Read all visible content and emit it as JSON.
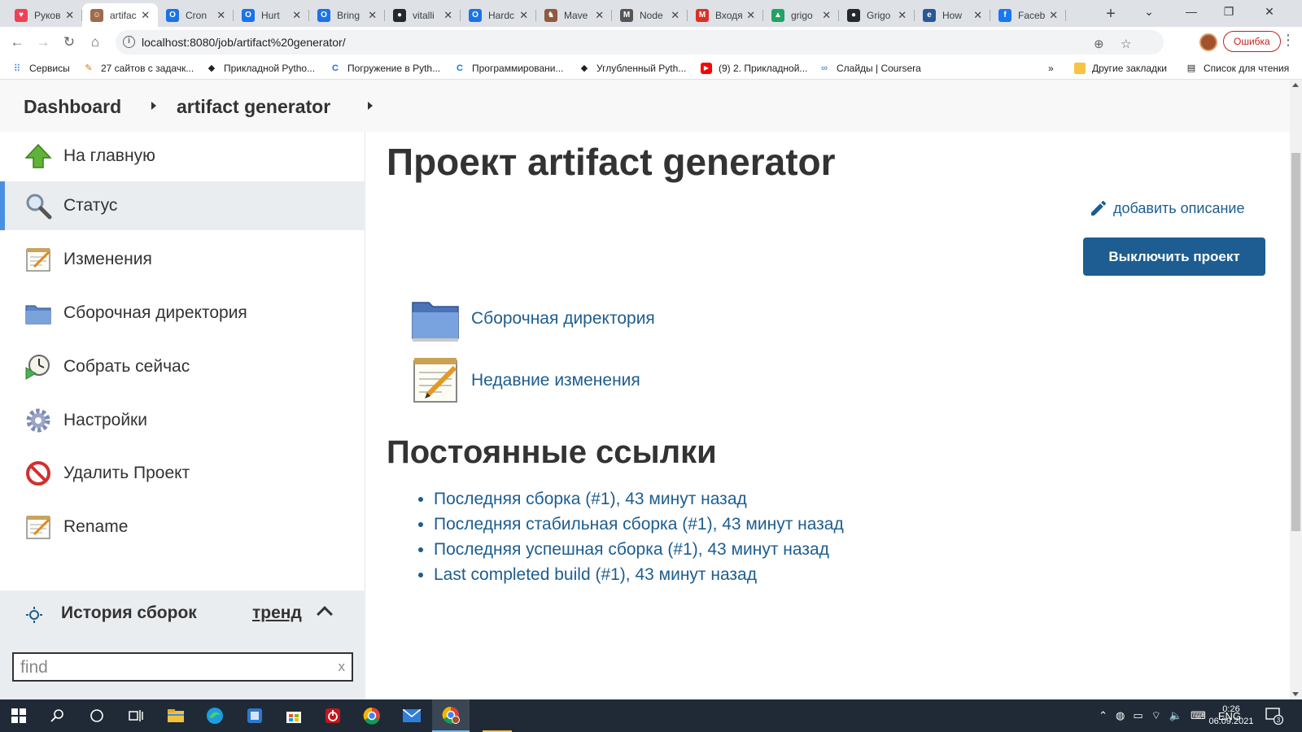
{
  "browser": {
    "tabs": [
      {
        "title": "Руков",
        "icon": "pocket-icon",
        "color": "#ef4056"
      },
      {
        "title": "artifac",
        "icon": "jenkins-icon",
        "color": "#a06a4c",
        "active": true
      },
      {
        "title": "Cron",
        "icon": "opera-icon",
        "color": "#1a73e8"
      },
      {
        "title": "Hurt",
        "icon": "opera-icon",
        "color": "#1a73e8"
      },
      {
        "title": "Bring",
        "icon": "opera-icon",
        "color": "#1a73e8"
      },
      {
        "title": "vitalli",
        "icon": "github-icon",
        "color": "#24292e"
      },
      {
        "title": "Hardc",
        "icon": "opera-icon",
        "color": "#1a73e8"
      },
      {
        "title": "Mave",
        "icon": "maven-icon",
        "color": "#8e5a40"
      },
      {
        "title": "Node",
        "icon": "mail-icon",
        "color": "#555555"
      },
      {
        "title": "Входя",
        "icon": "gmail-icon",
        "color": "#d93025"
      },
      {
        "title": "grigo",
        "icon": "drive-icon",
        "color": "#1fa463"
      },
      {
        "title": "Grigo",
        "icon": "github-icon",
        "color": "#24292e"
      },
      {
        "title": "How",
        "icon": "e-icon",
        "color": "#2b5797"
      },
      {
        "title": "Faceb",
        "icon": "facebook-icon",
        "color": "#1877f2"
      }
    ],
    "new_tab": "+",
    "url": "localhost:8080/job/artifact%20generator/",
    "error_label": "Ошибка",
    "bookmarks": [
      {
        "label": "Сервисы",
        "icon": "apps-icon"
      },
      {
        "label": "27 сайтов с задачк...",
        "icon": "bookmark-icon"
      },
      {
        "label": "Прикладной Pytho...",
        "icon": "stepik-icon"
      },
      {
        "label": "Погружение в Pyth...",
        "icon": "coursera-c-icon"
      },
      {
        "label": "Программировани...",
        "icon": "coursera-c-icon"
      },
      {
        "label": "Углубленный Pyth...",
        "icon": "stepik-icon"
      },
      {
        "label": "(9) 2. Прикладной...",
        "icon": "youtube-icon"
      },
      {
        "label": "Слайды | Coursera",
        "icon": "coursera-infinity-icon"
      }
    ],
    "bookmarks_more": "»",
    "other_bookmarks": "Другие закладки",
    "reading_list": "Список для чтения"
  },
  "jenkins": {
    "breadcrumb": [
      "Dashboard",
      "artifact generator"
    ],
    "sidebar": [
      {
        "label": "На главную",
        "icon": "up-arrow-icon"
      },
      {
        "label": "Статус",
        "icon": "search-icon",
        "active": true
      },
      {
        "label": "Изменения",
        "icon": "notepad-icon"
      },
      {
        "label": "Сборочная директория",
        "icon": "folder-icon"
      },
      {
        "label": "Собрать сейчас",
        "icon": "clock-play-icon"
      },
      {
        "label": "Настройки",
        "icon": "gear-icon"
      },
      {
        "label": "Удалить Проект",
        "icon": "no-entry-icon"
      },
      {
        "label": "Rename",
        "icon": "notepad-icon"
      }
    ],
    "build_history": {
      "title": "История сборок",
      "trend": "тренд",
      "search_placeholder": "find",
      "clear": "x"
    },
    "page_title": "Проект artifact generator",
    "add_description": "добавить описание",
    "disable_button": "Выключить проект",
    "main_links": [
      {
        "label": "Сборочная директория",
        "icon": "folder-icon"
      },
      {
        "label": "Недавние изменения",
        "icon": "notepad-icon"
      }
    ],
    "permalinks_title": "Постоянные ссылки",
    "permalinks": [
      "Последняя сборка (#1), 43 минут назад",
      "Последняя стабильная сборка (#1), 43 минут назад",
      "Последняя успешная сборка (#1), 43 минут назад",
      "Last completed build (#1), 43 минут назад"
    ]
  },
  "taskbar": {
    "lang": "ENG",
    "time": "0:26",
    "date": "06.09.2021",
    "notifications": "3"
  },
  "colors": {
    "link": "#1d5d91",
    "primary_button": "#1d5d91",
    "active_side": "#eaedf0",
    "active_border": "#4a90e2",
    "taskbar": "#1f2a36"
  }
}
